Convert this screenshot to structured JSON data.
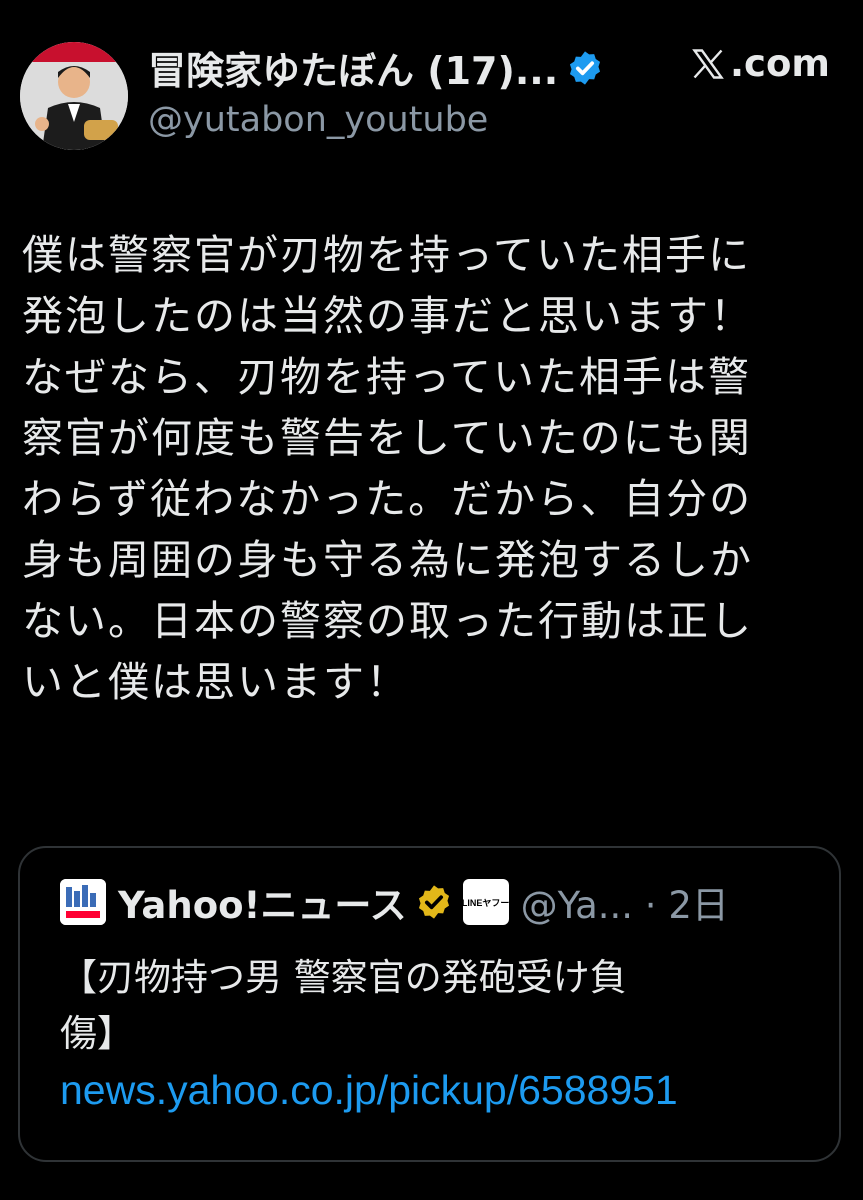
{
  "author": {
    "display_name": "冒険家ゆたぼん (17)...",
    "handle": "@yutabon_youtube",
    "verified_color": "#1d9bf0",
    "avatar": "profile-photo"
  },
  "site": {
    "logo": "x-logo-icon",
    "label": ".com"
  },
  "tweet": {
    "lines": [
      "僕は警察官が刃物を持っていた相手に",
      "発泡したのは当然の事だと思います！",
      "なぜなら、刃物を持っていた相手は警",
      "察官が何度も警告をしていたのにも関",
      "わらず従わなかった。だから、自分の",
      "身も周囲の身も守る為に発泡するしか",
      "ない。日本の警察の取った行動は正し",
      "いと僕は思います！"
    ]
  },
  "quote": {
    "name": "Yahoo!ニュース",
    "badge_color": "#e2b719",
    "line_badge": "LINEヤフー",
    "handle_time": "@Ya... · 2日",
    "text_lines": [
      "【刃物持つ男 警察官の発砲受け負",
      "傷】"
    ],
    "link": "news.yahoo.co.jp/pickup/6588951",
    "link_color": "#1d9bf0"
  }
}
